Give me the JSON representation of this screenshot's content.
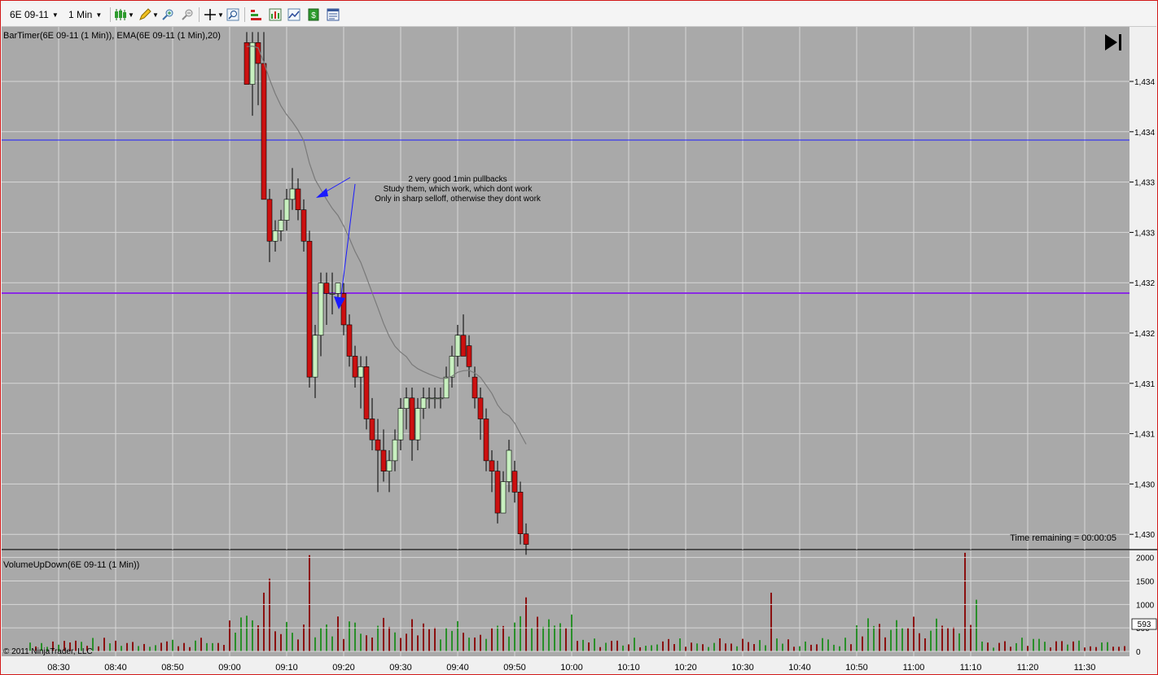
{
  "toolbar": {
    "instrument": "6E 09-11",
    "interval": "1 Min",
    "icons": [
      "candlestick-chart-style-icon",
      "drawing-pencil-icon",
      "zoom-in-icon",
      "zoom-out-icon",
      "crosshair-icon",
      "magnifier-icon",
      "bar-color-icon",
      "indicators-icon",
      "strategies-icon",
      "data-box-icon",
      "properties-icon"
    ]
  },
  "price_panel": {
    "indicator_label": "BarTimer(6E 09-11 (1 Min)), EMA(6E 09-11 (1 Min),20)",
    "annotation": [
      "2 very good 1min pullbacks",
      "Study them, which work, which dont work",
      "Only in sharp selloff, otherwise they dont work"
    ],
    "time_remaining": "Time remaining = 00:00:05",
    "price_labels": [
      "1,434",
      "1,434",
      "1,433",
      "1,433",
      "1,432",
      "1,432",
      "1,431",
      "1,431",
      "1,430",
      "1,430"
    ],
    "ema_color": "#7a7a7a",
    "up_color": "#c8f0c0",
    "down_color": "#cc1010",
    "hline_blue_color": "#1a1aff",
    "hline_purple_color": "#8a2be2"
  },
  "volume_panel": {
    "indicator_label": "VolumeUpDown(6E 09-11 (1 Min))",
    "axis_labels": [
      "2000",
      "1500",
      "1000",
      "500",
      "0"
    ],
    "current_value": "593",
    "up_color": "#2a8f2a",
    "down_color": "#8b1010"
  },
  "time_axis": [
    "08:30",
    "08:40",
    "08:50",
    "09:00",
    "09:10",
    "09:20",
    "09:30",
    "09:40",
    "09:50",
    "10:00",
    "10:10",
    "10:20",
    "10:30",
    "10:40",
    "10:50",
    "11:00",
    "11:10",
    "11:20",
    "11:30"
  ],
  "copyright": "© 2011 NinjaTrader, LLC",
  "chart_data": {
    "type": "candlestick",
    "price_series": {
      "name": "6E 09-11 (1 Min)",
      "bars": [
        {
          "time": "09:03",
          "open": 1.43445,
          "high": 1.43455,
          "low": 1.43405,
          "close": 1.43405
        },
        {
          "time": "09:04",
          "open": 1.43405,
          "high": 1.43455,
          "low": 1.43375,
          "close": 1.43445
        },
        {
          "time": "09:05",
          "open": 1.43445,
          "high": 1.43455,
          "low": 1.43385,
          "close": 1.43425
        },
        {
          "time": "09:06",
          "open": 1.43425,
          "high": 1.43455,
          "low": 1.43295,
          "close": 1.43295
        },
        {
          "time": "09:07",
          "open": 1.43295,
          "high": 1.43305,
          "low": 1.43235,
          "close": 1.43255
        },
        {
          "time": "09:08",
          "open": 1.43255,
          "high": 1.43275,
          "low": 1.43245,
          "close": 1.43265
        },
        {
          "time": "09:09",
          "open": 1.43265,
          "high": 1.43285,
          "low": 1.43255,
          "close": 1.43275
        },
        {
          "time": "09:10",
          "open": 1.43275,
          "high": 1.43305,
          "low": 1.43265,
          "close": 1.43295
        },
        {
          "time": "09:11",
          "open": 1.43295,
          "high": 1.43325,
          "low": 1.43285,
          "close": 1.43305
        },
        {
          "time": "09:12",
          "open": 1.43305,
          "high": 1.43315,
          "low": 1.43275,
          "close": 1.43285
        },
        {
          "time": "09:13",
          "open": 1.43285,
          "high": 1.43295,
          "low": 1.43245,
          "close": 1.43255
        },
        {
          "time": "09:14",
          "open": 1.43255,
          "high": 1.43265,
          "low": 1.43115,
          "close": 1.43125
        },
        {
          "time": "09:15",
          "open": 1.43125,
          "high": 1.43175,
          "low": 1.43105,
          "close": 1.43165
        },
        {
          "time": "09:16",
          "open": 1.43165,
          "high": 1.43225,
          "low": 1.43145,
          "close": 1.43215
        },
        {
          "time": "09:17",
          "open": 1.43215,
          "high": 1.43225,
          "low": 1.43175,
          "close": 1.43205
        },
        {
          "time": "09:18",
          "open": 1.43205,
          "high": 1.43225,
          "low": 1.43185,
          "close": 1.43205
        },
        {
          "time": "09:19",
          "open": 1.43205,
          "high": 1.43215,
          "low": 1.43195,
          "close": 1.43215
        },
        {
          "time": "09:20",
          "open": 1.43205,
          "high": 1.43215,
          "low": 1.43165,
          "close": 1.43175
        },
        {
          "time": "09:21",
          "open": 1.43175,
          "high": 1.43185,
          "low": 1.43135,
          "close": 1.43145
        },
        {
          "time": "09:22",
          "open": 1.43145,
          "high": 1.43155,
          "low": 1.43115,
          "close": 1.43125
        },
        {
          "time": "09:23",
          "open": 1.43125,
          "high": 1.43145,
          "low": 1.43095,
          "close": 1.43135
        },
        {
          "time": "09:24",
          "open": 1.43135,
          "high": 1.43145,
          "low": 1.43075,
          "close": 1.43085
        },
        {
          "time": "09:25",
          "open": 1.43085,
          "high": 1.43105,
          "low": 1.43055,
          "close": 1.43065
        },
        {
          "time": "09:26",
          "open": 1.43065,
          "high": 1.43085,
          "low": 1.43015,
          "close": 1.43055
        },
        {
          "time": "09:27",
          "open": 1.43055,
          "high": 1.43075,
          "low": 1.43025,
          "close": 1.43035
        },
        {
          "time": "09:28",
          "open": 1.43035,
          "high": 1.43055,
          "low": 1.43015,
          "close": 1.43045
        },
        {
          "time": "09:29",
          "open": 1.43045,
          "high": 1.43075,
          "low": 1.43035,
          "close": 1.43065
        },
        {
          "time": "09:30",
          "open": 1.43065,
          "high": 1.43105,
          "low": 1.43055,
          "close": 1.43095
        },
        {
          "time": "09:31",
          "open": 1.43095,
          "high": 1.43115,
          "low": 1.43075,
          "close": 1.43105
        },
        {
          "time": "09:32",
          "open": 1.43105,
          "high": 1.43115,
          "low": 1.43045,
          "close": 1.43065
        },
        {
          "time": "09:33",
          "open": 1.43065,
          "high": 1.43105,
          "low": 1.43055,
          "close": 1.43095
        },
        {
          "time": "09:34",
          "open": 1.43095,
          "high": 1.43115,
          "low": 1.43085,
          "close": 1.43105
        },
        {
          "time": "09:35",
          "open": 1.43105,
          "high": 1.43115,
          "low": 1.43095,
          "close": 1.43105
        },
        {
          "time": "09:36",
          "open": 1.43105,
          "high": 1.43115,
          "low": 1.43095,
          "close": 1.43105
        },
        {
          "time": "09:37",
          "open": 1.43105,
          "high": 1.43115,
          "low": 1.43095,
          "close": 1.43105
        },
        {
          "time": "09:38",
          "open": 1.43105,
          "high": 1.43135,
          "low": 1.43105,
          "close": 1.43125
        },
        {
          "time": "09:39",
          "open": 1.43125,
          "high": 1.43155,
          "low": 1.43115,
          "close": 1.43145
        },
        {
          "time": "09:40",
          "open": 1.43145,
          "high": 1.43175,
          "low": 1.43135,
          "close": 1.43165
        },
        {
          "time": "09:41",
          "open": 1.43165,
          "high": 1.43185,
          "low": 1.43145,
          "close": 1.43145
        },
        {
          "time": "09:42",
          "open": 1.43155,
          "high": 1.43165,
          "low": 1.43125,
          "close": 1.43135
        },
        {
          "time": "09:43",
          "open": 1.43125,
          "high": 1.43135,
          "low": 1.43095,
          "close": 1.43105
        },
        {
          "time": "09:44",
          "open": 1.43105,
          "high": 1.43115,
          "low": 1.43065,
          "close": 1.43085
        },
        {
          "time": "09:45",
          "open": 1.43085,
          "high": 1.43095,
          "low": 1.43035,
          "close": 1.43045
        },
        {
          "time": "09:46",
          "open": 1.43045,
          "high": 1.43055,
          "low": 1.43015,
          "close": 1.43035
        },
        {
          "time": "09:47",
          "open": 1.43035,
          "high": 1.43045,
          "low": 1.42985,
          "close": 1.42995
        },
        {
          "time": "09:48",
          "open": 1.42995,
          "high": 1.43035,
          "low": 1.42995,
          "close": 1.43025
        },
        {
          "time": "09:49",
          "open": 1.43025,
          "high": 1.43065,
          "low": 1.43015,
          "close": 1.43055
        },
        {
          "time": "09:50",
          "open": 1.43035,
          "high": 1.43045,
          "low": 1.43005,
          "close": 1.43015
        },
        {
          "time": "09:51",
          "open": 1.43015,
          "high": 1.43025,
          "low": 1.42965,
          "close": 1.42975
        },
        {
          "time": "09:52",
          "open": 1.42975,
          "high": 1.42985,
          "low": 1.42955,
          "close": 1.42965
        }
      ]
    },
    "ema_period": 20,
    "horizontal_lines": [
      {
        "price": 1.43395,
        "color": "blue"
      },
      {
        "price": 1.43245,
        "color": "purple"
      }
    ],
    "y_range": [
      1.4296,
      1.4346
    ],
    "volume": {
      "name": "VolumeUpDown(6E 09-11 (1 Min))",
      "y_range": [
        0,
        2150
      ],
      "highlights": [
        {
          "time": "09:06",
          "value": 1250,
          "direction": "down"
        },
        {
          "time": "09:07",
          "value": 1550,
          "direction": "down"
        },
        {
          "time": "09:14",
          "value": 2050,
          "direction": "down"
        },
        {
          "time": "09:52",
          "value": 1150,
          "direction": "down"
        },
        {
          "time": "10:35",
          "value": 1250,
          "direction": "down"
        },
        {
          "time": "11:09",
          "value": 2100,
          "direction": "down"
        },
        {
          "time": "11:11",
          "value": 1100,
          "direction": "up"
        }
      ],
      "last_value": 593
    }
  }
}
